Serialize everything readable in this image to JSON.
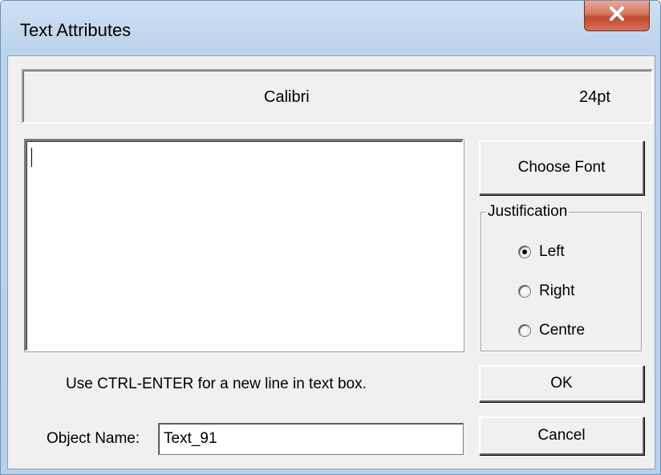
{
  "window": {
    "title": "Text Attributes",
    "close_symbol": "x"
  },
  "font_display": {
    "font_name": "Calibri",
    "font_size": "24pt"
  },
  "text_box": {
    "value": ""
  },
  "buttons": {
    "choose_font": "Choose Font",
    "ok": "OK",
    "cancel": "Cancel"
  },
  "justification": {
    "label": "Justification",
    "options": [
      {
        "label": "Left",
        "selected": true
      },
      {
        "label": "Right",
        "selected": false
      },
      {
        "label": "Centre",
        "selected": false
      }
    ]
  },
  "hint": "Use CTRL-ENTER for a new line in text box.",
  "object_name": {
    "label": "Object Name:",
    "value": "Text_91"
  },
  "colors": {
    "close_button": "#c2492d",
    "dialog_face": "#f0f0f0",
    "title_bar": "#bcd3ec"
  }
}
